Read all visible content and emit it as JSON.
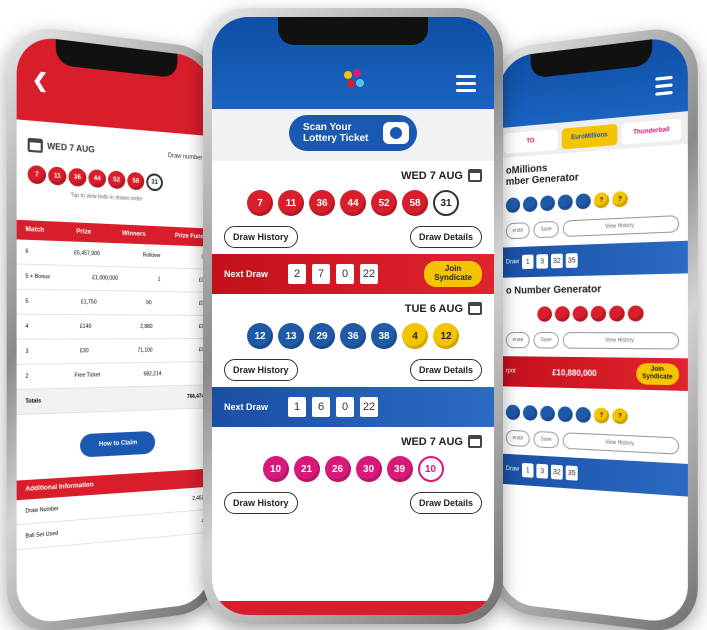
{
  "left_phone": {
    "draw_date": "WED 7 AUG",
    "draw_number_label": "Draw number",
    "balls": [
      "7",
      "11",
      "36",
      "44",
      "52",
      "58",
      "31"
    ],
    "tap_note": "Tap to view balls in drawn order",
    "table_headers": [
      "Match",
      "Prize",
      "Winners",
      "Prize Fund"
    ],
    "rows": [
      {
        "match": "6",
        "prize": "£6,457,900",
        "winners": "Rollover",
        "fund": "0"
      },
      {
        "match": "5 + Bonus",
        "prize": "£1,000,000",
        "winners": "1",
        "fund": "£0"
      },
      {
        "match": "5",
        "prize": "£1,750",
        "winners": "90",
        "fund": "£0"
      },
      {
        "match": "4",
        "prize": "£140",
        "winners": "2,880",
        "fund": "£0"
      },
      {
        "match": "3",
        "prize": "£30",
        "winners": "71,100",
        "fund": "£0"
      },
      {
        "match": "2",
        "prize": "Free Ticket",
        "winners": "682,214",
        "fund": "-"
      }
    ],
    "totals_label": "Totals",
    "totals_value": "766,474",
    "how_to_claim": "How to Claim",
    "additional_info": "Additional Information",
    "draw_number_row": "Draw Number",
    "draw_number_value": "2,462",
    "ball_set_row": "Ball Set Used",
    "ball_set_value": "4"
  },
  "center_phone": {
    "scan_button": {
      "line1": "Scan Your",
      "line2": "Lottery Ticket"
    },
    "draws": [
      {
        "date": "WED 7 AUG",
        "balls": [
          {
            "n": "7",
            "c": "red"
          },
          {
            "n": "11",
            "c": "red"
          },
          {
            "n": "36",
            "c": "red"
          },
          {
            "n": "44",
            "c": "red"
          },
          {
            "n": "52",
            "c": "red"
          },
          {
            "n": "58",
            "c": "red"
          },
          {
            "n": "31",
            "c": "bonus"
          }
        ],
        "history_label": "Draw History",
        "details_label": "Draw Details",
        "next": {
          "label": "Next Draw",
          "digits": [
            "2",
            "7",
            "0",
            "22"
          ],
          "syndicate_line1": "Join",
          "syndicate_line2": "Syndicate",
          "style": "red"
        }
      },
      {
        "date": "TUE 6 AUG",
        "balls": [
          {
            "n": "12",
            "c": "blue"
          },
          {
            "n": "13",
            "c": "blue"
          },
          {
            "n": "29",
            "c": "blue"
          },
          {
            "n": "36",
            "c": "blue"
          },
          {
            "n": "38",
            "c": "blue"
          },
          {
            "n": "4",
            "c": "yellow"
          },
          {
            "n": "12",
            "c": "yellow"
          }
        ],
        "history_label": "Draw History",
        "details_label": "Draw Details",
        "next": {
          "label": "Next Draw",
          "digits": [
            "1",
            "6",
            "0",
            "22"
          ],
          "style": "blue"
        }
      },
      {
        "date": "WED 7 AUG",
        "balls": [
          {
            "n": "10",
            "c": "pink"
          },
          {
            "n": "21",
            "c": "pink"
          },
          {
            "n": "26",
            "c": "pink"
          },
          {
            "n": "30",
            "c": "pink"
          },
          {
            "n": "39",
            "c": "pink"
          },
          {
            "n": "10",
            "c": "bonus-pink"
          }
        ],
        "history_label": "Draw History",
        "details_label": "Draw Details"
      }
    ]
  },
  "right_phone": {
    "tabs": [
      "TO",
      "EuroMillions",
      "Thunderball"
    ],
    "gen1_title_line1": "oMillions",
    "gen1_title_line2": "mber Generator",
    "gen1_balls": [
      {
        "n": "",
        "c": "blue"
      },
      {
        "n": "",
        "c": "blue"
      },
      {
        "n": "",
        "c": "blue"
      },
      {
        "n": "",
        "c": "blue"
      },
      {
        "n": "",
        "c": "blue"
      },
      {
        "n": "?",
        "c": "yellow"
      },
      {
        "n": "?",
        "c": "yellow"
      }
    ],
    "gen_buttons": [
      "erate",
      "Save",
      "View History"
    ],
    "bar1_label": "Draw",
    "bar1_digits": [
      "1",
      "3",
      "32",
      "35"
    ],
    "gen2_title": "o Number Generator",
    "gen2_balls": [
      {
        "n": "",
        "c": "red"
      },
      {
        "n": "",
        "c": "red"
      },
      {
        "n": "",
        "c": "red"
      },
      {
        "n": "",
        "c": "red"
      },
      {
        "n": "",
        "c": "red"
      },
      {
        "n": "",
        "c": "red"
      }
    ],
    "jackpot_label": "rpot",
    "jackpot": "£10,880,000",
    "jackpot_syndicate_line1": "Join",
    "jackpot_syndicate_line2": "Syndicate",
    "gen3_balls": [
      {
        "n": "",
        "c": "blue"
      },
      {
        "n": "",
        "c": "blue"
      },
      {
        "n": "",
        "c": "blue"
      },
      {
        "n": "",
        "c": "blue"
      },
      {
        "n": "",
        "c": "blue"
      },
      {
        "n": "?",
        "c": "yellow"
      },
      {
        "n": "?",
        "c": "yellow"
      }
    ],
    "bar2_label": "Draw",
    "bar2_digits": [
      "1",
      "3",
      "32",
      "35"
    ]
  },
  "colors": {
    "brand_red": "#d81e2a",
    "brand_blue": "#1a58b2",
    "yellow": "#f5c400",
    "pink": "#d8197a"
  }
}
